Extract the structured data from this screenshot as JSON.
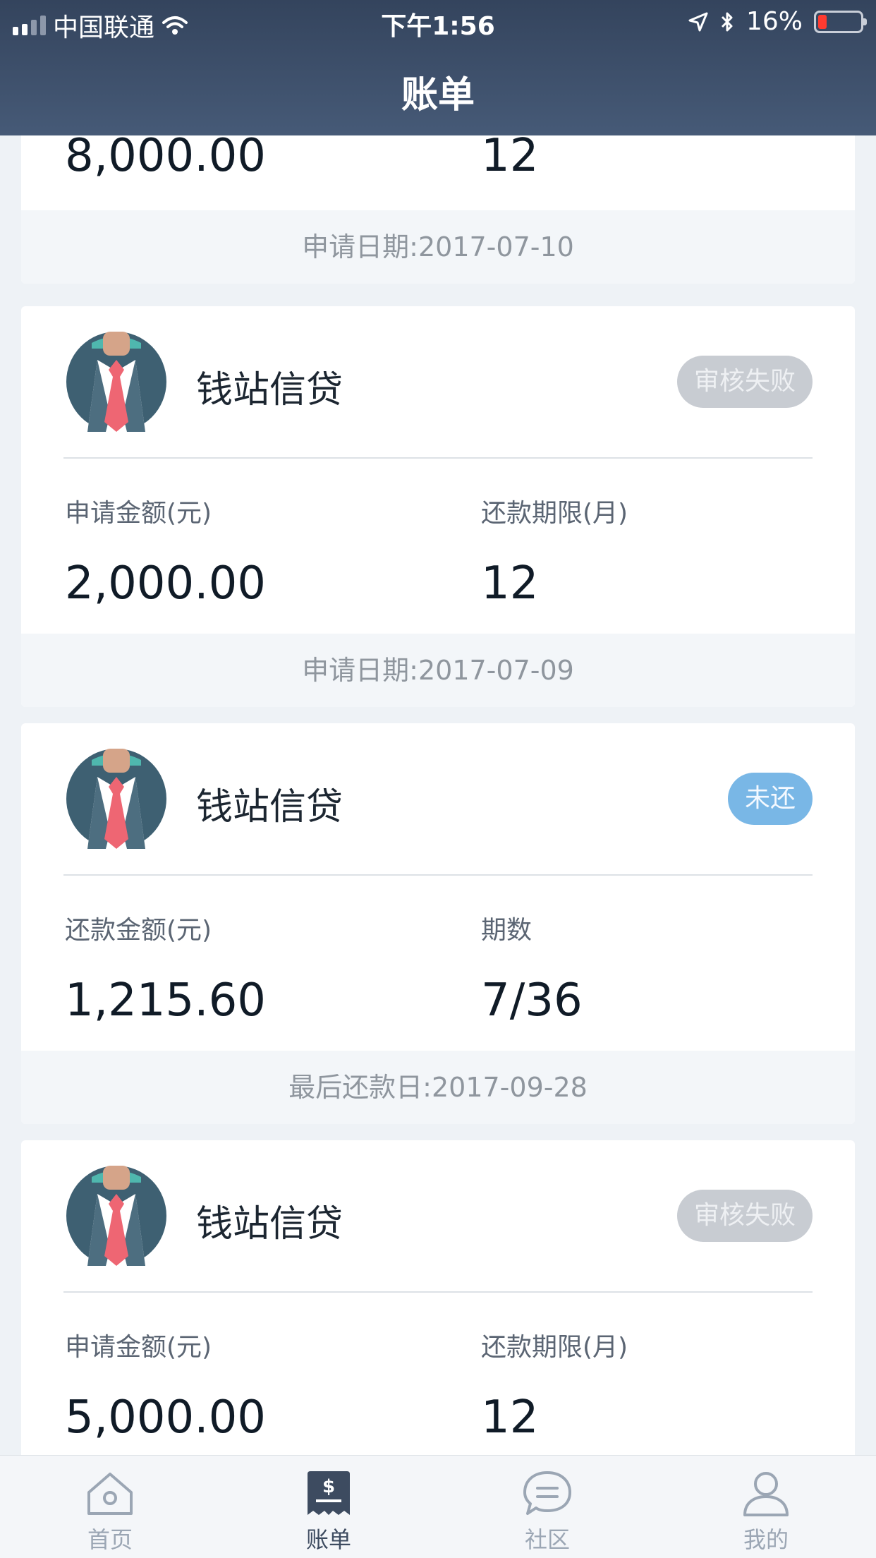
{
  "status_bar": {
    "carrier": "中国联通",
    "time": "下午1:56",
    "battery": "16%"
  },
  "header": {
    "title": "账单"
  },
  "partial_card": {
    "amount": "8,000.00",
    "term": "12",
    "footer": "申请日期:2017-07-10"
  },
  "cards": [
    {
      "lender": "钱站信贷",
      "status": "审核失败",
      "label1": "申请金额(元)",
      "value1": "2,000.00",
      "label2": "还款期限(月)",
      "value2": "12",
      "footer": "申请日期:2017-07-09"
    },
    {
      "lender": "钱站信贷",
      "status": "未还",
      "label1": "还款金额(元)",
      "value1": "1,215.60",
      "label2": "期数",
      "value2": "7/36",
      "footer": "最后还款日:2017-09-28"
    },
    {
      "lender": "钱站信贷",
      "status": "审核失败",
      "label1": "申请金额(元)",
      "value1": "5,000.00",
      "label2": "还款期限(月)",
      "value2": "12"
    }
  ],
  "tabbar": {
    "home": "首页",
    "bill": "账单",
    "community": "社区",
    "mine": "我的"
  },
  "colors": {
    "header": "#3a4b65",
    "badge_failed": "#c8ccd2",
    "badge_unpaid": "#79b7e6",
    "avatar_bg": "#3e6072",
    "tie": "#ee6673"
  }
}
